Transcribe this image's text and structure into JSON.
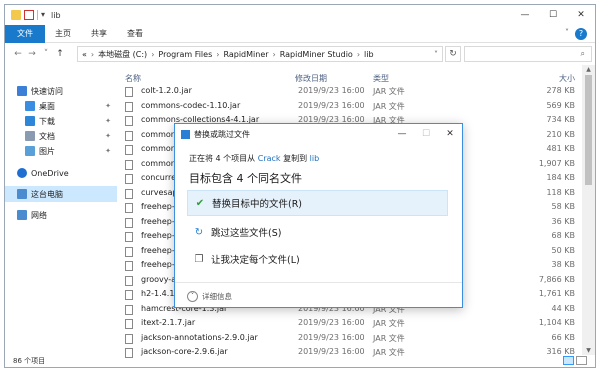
{
  "window": {
    "path_label": "lib",
    "controls": {
      "minimize": "—",
      "maximize": "☐",
      "close": "✕"
    }
  },
  "ribbon": {
    "tabs": [
      "文件",
      "主页",
      "共享",
      "查看"
    ],
    "collapse": "˅",
    "help": "?"
  },
  "nav": {
    "back": "←",
    "forward": "→",
    "recent": "˅",
    "up": "↑",
    "address_prefix": "«",
    "address": [
      "本地磁盘 (C:)",
      "Program Files",
      "RapidMiner",
      "RapidMiner Studio",
      "lib"
    ],
    "address_dropdown": "˅",
    "refresh": "↻",
    "search_placeholder": "",
    "search_icon": "⌕"
  },
  "sidebar": {
    "items": [
      {
        "label": "快速访问",
        "icon": "star-icon",
        "color": "#3b7fd6",
        "pinned": false
      },
      {
        "label": "桌面",
        "icon": "desktop-icon",
        "color": "#3a8de0",
        "pinned": true
      },
      {
        "label": "下载",
        "icon": "download-icon",
        "color": "#2d86d8",
        "pinned": true
      },
      {
        "label": "文档",
        "icon": "document-icon",
        "color": "#8a9ab0",
        "pinned": true
      },
      {
        "label": "图片",
        "icon": "picture-icon",
        "color": "#59a0d8",
        "pinned": true
      },
      {
        "label": "OneDrive",
        "icon": "cloud-icon",
        "color": "#1f6fd1",
        "pinned": false
      },
      {
        "label": "这台电脑",
        "icon": "computer-icon",
        "color": "#4a8ccf",
        "pinned": false
      },
      {
        "label": "网络",
        "icon": "network-icon",
        "color": "#4a8ccf",
        "pinned": false
      }
    ],
    "pin_glyph": "📌"
  },
  "list": {
    "headers": {
      "name": "名称",
      "date": "修改日期",
      "type": "类型",
      "size": "大小"
    },
    "files": [
      {
        "name": "colt-1.2.0.jar",
        "date": "2019/9/23 16:00",
        "type": "JAR 文件",
        "size": "278 KB"
      },
      {
        "name": "commons-codec-1.10.jar",
        "date": "2019/9/23 16:00",
        "type": "JAR 文件",
        "size": "569 KB"
      },
      {
        "name": "commons-collections4-4.1.jar",
        "date": "2019/9/23 16:00",
        "type": "JAR 文件",
        "size": "734 KB"
      },
      {
        "name": "common",
        "date": "",
        "type": "",
        "size": "210 KB"
      },
      {
        "name": "common",
        "date": "",
        "type": "",
        "size": "481 KB"
      },
      {
        "name": "common",
        "date": "",
        "type": "",
        "size": "1,907 KB"
      },
      {
        "name": "concurre",
        "date": "",
        "type": "",
        "size": "184 KB"
      },
      {
        "name": "curvesap",
        "date": "",
        "type": "",
        "size": "118 KB"
      },
      {
        "name": "freehep-",
        "date": "",
        "type": "",
        "size": "58 KB"
      },
      {
        "name": "freehep-",
        "date": "",
        "type": "",
        "size": "36 KB"
      },
      {
        "name": "freehep-",
        "date": "",
        "type": "",
        "size": "68 KB"
      },
      {
        "name": "freehep-",
        "date": "",
        "type": "",
        "size": "50 KB"
      },
      {
        "name": "freehep-",
        "date": "",
        "type": "",
        "size": "38 KB"
      },
      {
        "name": "groovy-a",
        "date": "",
        "type": "",
        "size": "7,866 KB"
      },
      {
        "name": "h2-1.4.19",
        "date": "",
        "type": "",
        "size": "1,761 KB"
      },
      {
        "name": "hamcrest-core-1.3.jar",
        "date": "2019/9/23 16:00",
        "type": "JAR 文件",
        "size": "44 KB"
      },
      {
        "name": "itext-2.1.7.jar",
        "date": "2019/9/23 16:00",
        "type": "JAR 文件",
        "size": "1,104 KB"
      },
      {
        "name": "jackson-annotations-2.9.0.jar",
        "date": "2019/9/23 16:00",
        "type": "JAR 文件",
        "size": "66 KB"
      },
      {
        "name": "jackson-core-2.9.6.jar",
        "date": "2019/9/23 16:00",
        "type": "JAR 文件",
        "size": "316 KB"
      }
    ]
  },
  "scrollbar": {
    "up": "▲",
    "down": "▼"
  },
  "status": {
    "count": "86 个项目"
  },
  "dialog": {
    "title": "替换或跳过文件",
    "controls": {
      "minimize": "—",
      "maximize": "☐",
      "close": "✕"
    },
    "sub_prefix": "正在将 4 个项目从",
    "source": "Crack",
    "sub_middle": "复制到",
    "dest": "lib",
    "heading": "目标包含 4 个同名文件",
    "options": [
      {
        "icon": "✔",
        "label": "替换目标中的文件(R)",
        "color": "#2e9d3a"
      },
      {
        "icon": "↻",
        "label": "跳过这些文件(S)",
        "color": "#2a7fd4"
      },
      {
        "icon": "❐",
        "label": "让我决定每个文件(L)",
        "color": "#555555"
      }
    ],
    "details_icon": "˅",
    "details": "详细信息"
  }
}
